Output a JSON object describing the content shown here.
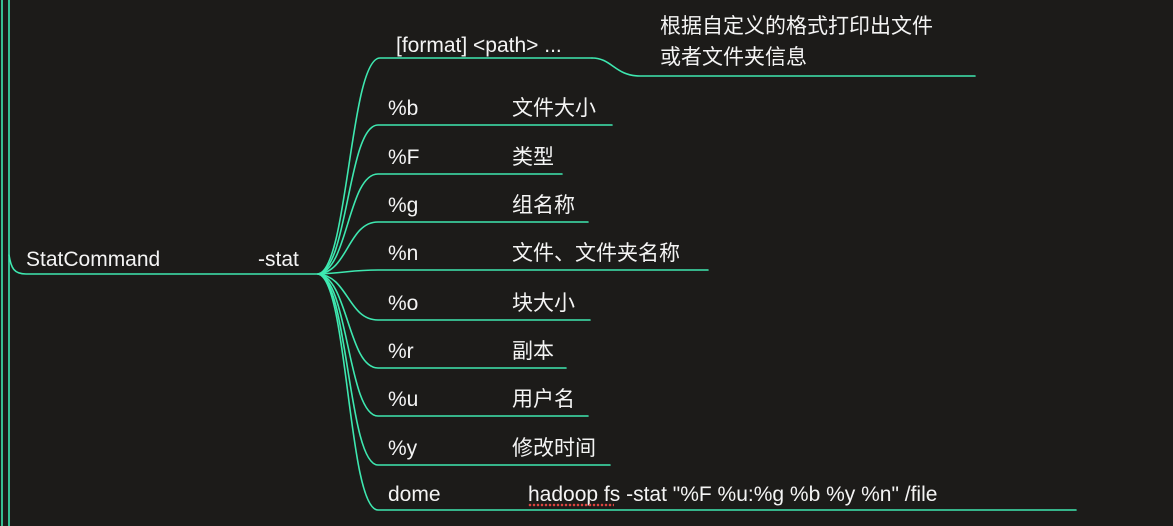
{
  "colors": {
    "background": "#1c1b19",
    "branch": "#3ee8b0",
    "text": "#f4f4f4",
    "spellcheck": "#d9443e"
  },
  "root": {
    "label": "StatCommand"
  },
  "command": {
    "label": "-stat"
  },
  "usage": {
    "syntax": "[format] <path> ...",
    "description_line1": "根据自定义的格式打印出文件",
    "description_line2": "或者文件夹信息"
  },
  "options": [
    {
      "key": "%b",
      "desc": "文件大小"
    },
    {
      "key": "%F",
      "desc": "类型"
    },
    {
      "key": "%g",
      "desc": "组名称"
    },
    {
      "key": "%n",
      "desc": "文件、文件夹名称"
    },
    {
      "key": "%o",
      "desc": "块大小"
    },
    {
      "key": "%r",
      "desc": "副本"
    },
    {
      "key": "%u",
      "desc": "用户名"
    },
    {
      "key": "%y",
      "desc": "修改时间"
    }
  ],
  "demo": {
    "key": "dome",
    "command": "hadoop fs -stat \"%F %u:%g %b %y %n\" /file"
  }
}
